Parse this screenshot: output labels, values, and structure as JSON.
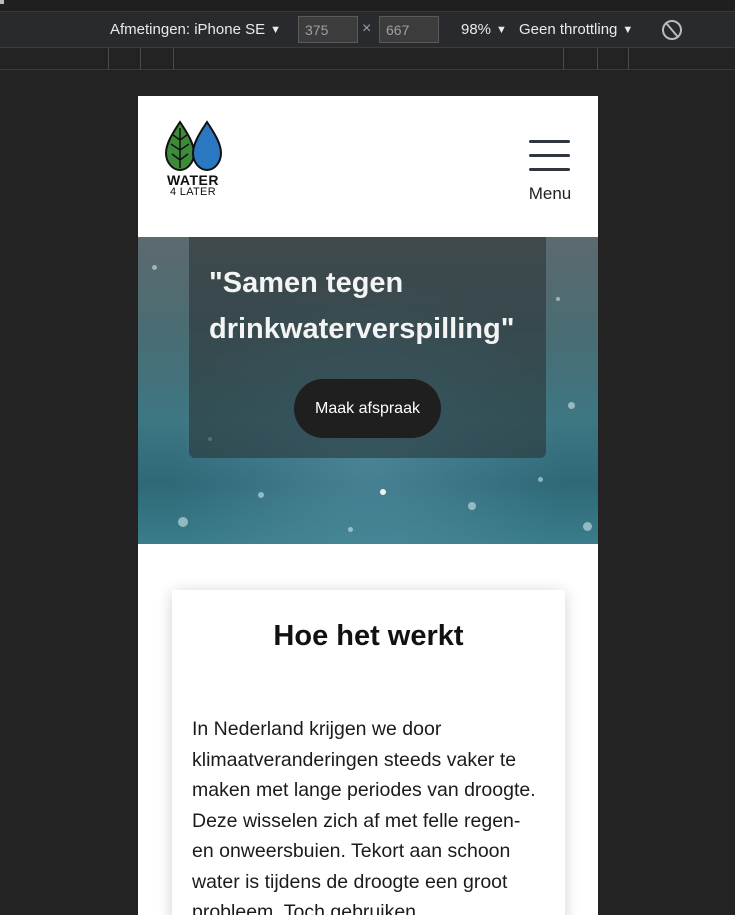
{
  "devtools": {
    "dimensions_label": "Afmetingen: iPhone SE",
    "width_value": "375",
    "times": "×",
    "height_value": "667",
    "zoom_label": "98%",
    "throttling_label": "Geen throttling",
    "rotate_icon": "rotate-icon"
  },
  "site": {
    "logo": {
      "line1": "WATER",
      "line2": "4 LATER"
    },
    "menu_label": "Menu",
    "hero": {
      "title": "\"Samen tegen drinkwaterverspilling\"",
      "button_label": "Maak afspraak"
    },
    "card": {
      "title": "Hoe het werkt",
      "text": "In Nederland krijgen we door klimaatveranderingen steeds vaker te maken met lange periodes van droogte. Deze wisselen zich af met felle regen- en onweersbuien. Tekort aan schoon water is tijdens de droogte een groot probleem. Toch gebruiken"
    }
  },
  "colors": {
    "devtools_bg": "#292a2d",
    "leaf_green": "#3d8a3a",
    "drop_blue": "#2a78c2",
    "hero_button": "#1f1f1f"
  }
}
